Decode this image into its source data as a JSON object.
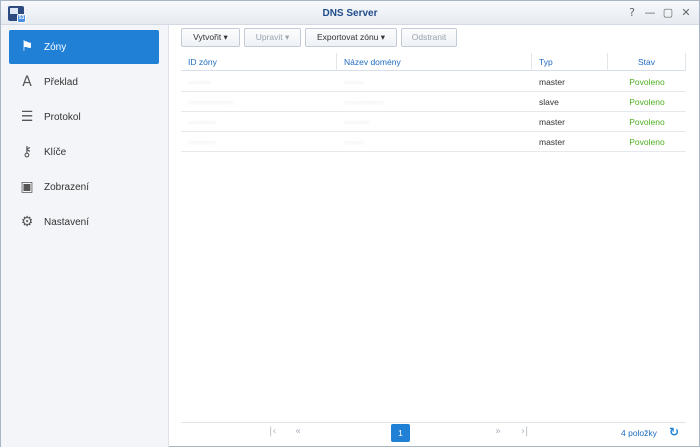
{
  "window": {
    "title": "DNS Server",
    "controls": [
      "?",
      "—",
      "▢",
      "✕"
    ]
  },
  "sidebar": {
    "items": [
      {
        "label": "Zóny",
        "icon": "flag-icon",
        "glyph": "⚑",
        "active": true
      },
      {
        "label": "Překlad",
        "icon": "translate-icon",
        "glyph": "🔤",
        "active": false
      },
      {
        "label": "Protokol",
        "icon": "log-icon",
        "glyph": "☰",
        "active": false
      },
      {
        "label": "Klíče",
        "icon": "key-icon",
        "glyph": "⚷",
        "active": false
      },
      {
        "label": "Zobrazení",
        "icon": "view-icon",
        "glyph": "▣",
        "active": false
      },
      {
        "label": "Nastavení",
        "icon": "gear-icon",
        "glyph": "⚙",
        "active": false
      }
    ]
  },
  "toolbar": {
    "create_label": "Vytvořit ▾",
    "edit_label": "Upravit ▾",
    "export_label": "Exportovat zónu ▾",
    "delete_label": "Odstranit"
  },
  "table": {
    "headers": [
      "ID zóny",
      "Název domény",
      "Typ",
      "Stav"
    ],
    "rows": [
      {
        "id": "········",
        "domain": "·······",
        "type": "master",
        "status": "Povoleno"
      },
      {
        "id": "················",
        "domain": "··············",
        "type": "slave",
        "status": "Povoleno"
      },
      {
        "id": "··········",
        "domain": "·········",
        "type": "master",
        "status": "Povoleno"
      },
      {
        "id": "··········",
        "domain": "·······",
        "type": "master",
        "status": "Povoleno"
      }
    ]
  },
  "pager": {
    "first": "|‹",
    "prev": "«",
    "page": "1",
    "next": "»",
    "last": "›|",
    "count": "4 položky",
    "refresh": "↻"
  },
  "colors": {
    "accent": "#1f80d6",
    "enabled": "#4cae1f",
    "header_text": "#1f6bc0"
  }
}
